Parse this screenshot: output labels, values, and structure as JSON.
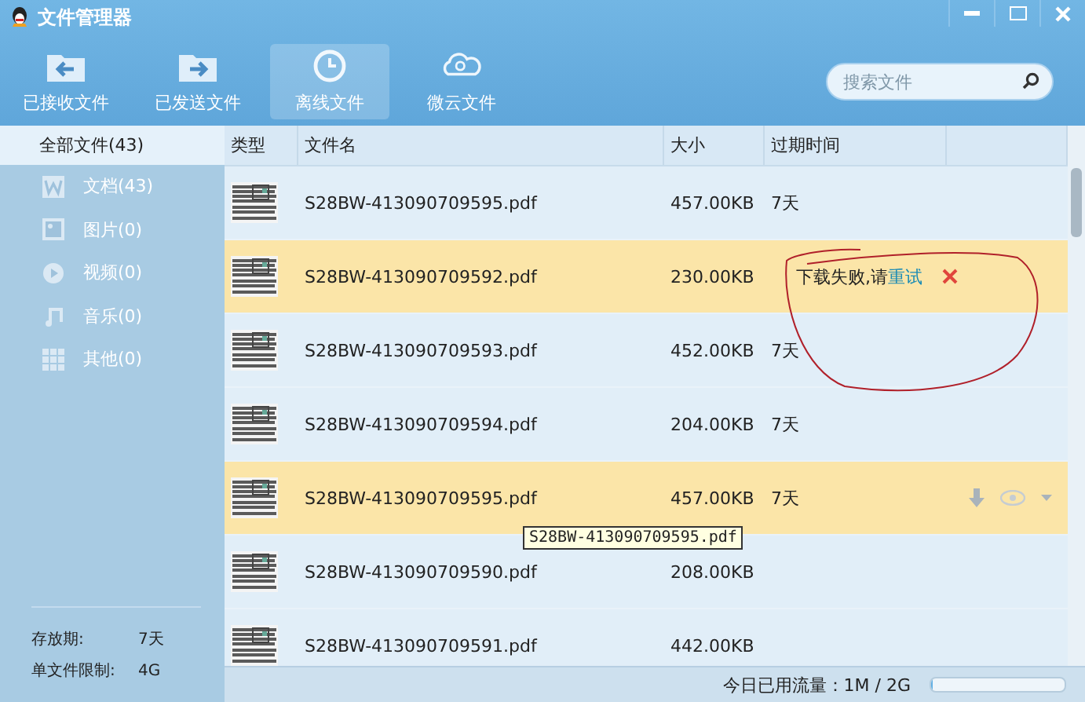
{
  "window": {
    "title": "文件管理器"
  },
  "tabs": [
    {
      "label": "已接收文件",
      "selected": false
    },
    {
      "label": "已发送文件",
      "selected": false
    },
    {
      "label": "离线文件",
      "selected": true
    },
    {
      "label": "微云文件",
      "selected": false
    }
  ],
  "search": {
    "placeholder": "搜索文件"
  },
  "sidebar": {
    "all": {
      "label": "全部文件(43)",
      "selected": true
    },
    "items": [
      {
        "label": "文档(43)",
        "selected": false
      },
      {
        "label": "图片(0)",
        "selected": false
      },
      {
        "label": "视频(0)",
        "selected": false
      },
      {
        "label": "音乐(0)",
        "selected": false
      },
      {
        "label": "其他(0)",
        "selected": false
      }
    ],
    "info": [
      {
        "label": "存放期:",
        "value": "7天"
      },
      {
        "label": "单文件限制:",
        "value": "4G"
      }
    ]
  },
  "table": {
    "columns": [
      "类型",
      "文件名",
      "大小",
      "过期时间"
    ],
    "rows": [
      {
        "kind": "normal",
        "name": "S28BW-413090709595.pdf",
        "size": "457.00KB",
        "expiry": "7天",
        "highlighted": false
      },
      {
        "kind": "failed",
        "name": "S28BW-413090709592.pdf",
        "size": "230.00KB",
        "message": "下载失败,请",
        "retry": "重试",
        "highlighted": true
      },
      {
        "kind": "normal",
        "name": "S28BW-413090709593.pdf",
        "size": "452.00KB",
        "expiry": "7天",
        "highlighted": false
      },
      {
        "kind": "normal",
        "name": "S28BW-413090709594.pdf",
        "size": "204.00KB",
        "expiry": "7天",
        "highlighted": false
      },
      {
        "kind": "hover",
        "name": "S28BW-413090709595.pdf",
        "size": "457.00KB",
        "expiry": "7天",
        "highlighted": true
      },
      {
        "kind": "normal",
        "name": "S28BW-413090709590.pdf",
        "size": "208.00KB",
        "highlighted": false
      },
      {
        "kind": "normal",
        "name": "S28BW-413090709591.pdf",
        "size": "442.00KB",
        "highlighted": false
      }
    ]
  },
  "tooltip": "S28BW-413090709595.pdf",
  "status_bar": {
    "label": "今日已用流量：1M / 2G",
    "level": 0.01
  }
}
